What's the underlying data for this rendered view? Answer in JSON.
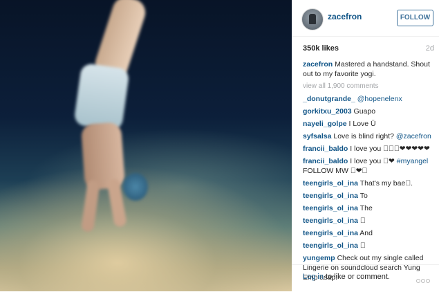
{
  "post": {
    "image_icon": "handstand-photo",
    "username": "zacefron",
    "follow_label": "FOLLOW",
    "likes": "350k likes",
    "age": "2d",
    "caption": "Mastered a handstand. Shout out to my favorite yogi.",
    "view_all": "view all 1,900 comments",
    "login_link": "Log in",
    "login_rest": " to like or comment.",
    "more_icon": "more-options-icon"
  },
  "comments": [
    {
      "user": "_donutgrande_",
      "text": "",
      "mention": "@hopenelenx"
    },
    {
      "user": "gorkitxu_2003",
      "text": "Guapo",
      "mention": ""
    },
    {
      "user": "nayeli_golpe",
      "text": "I Love Ü",
      "mention": ""
    },
    {
      "user": "syfsalsa",
      "text": "Love is blind right? ",
      "mention": "@zacefron"
    },
    {
      "user": "francii_baldo",
      "text": "I love you 􀀀􀀀􀀀❤❤❤❤❤",
      "mention": ""
    },
    {
      "user": "francii_baldo",
      "text": "I love you 􀀀❤ ",
      "mention": "#myangel",
      "extra": "FOLLOW MW 􀀀❤􀀀"
    },
    {
      "user": "teengirls_ol_ina",
      "text": "That's my bae􀀀.",
      "mention": ""
    },
    {
      "user": "teengirls_ol_ina",
      "text": "To",
      "mention": ""
    },
    {
      "user": "teengirls_ol_ina",
      "text": "The",
      "mention": ""
    },
    {
      "user": "teengirls_ol_ina",
      "text": "􀀀",
      "mention": ""
    },
    {
      "user": "teengirls_ol_ina",
      "text": "And",
      "mention": ""
    },
    {
      "user": "teengirls_ol_ina",
      "text": "􀀀",
      "mention": ""
    },
    {
      "user": "yungemp",
      "text": "Check out my single called Lingerie on soundcloud search Yung Emp asap!",
      "mention": ""
    }
  ]
}
